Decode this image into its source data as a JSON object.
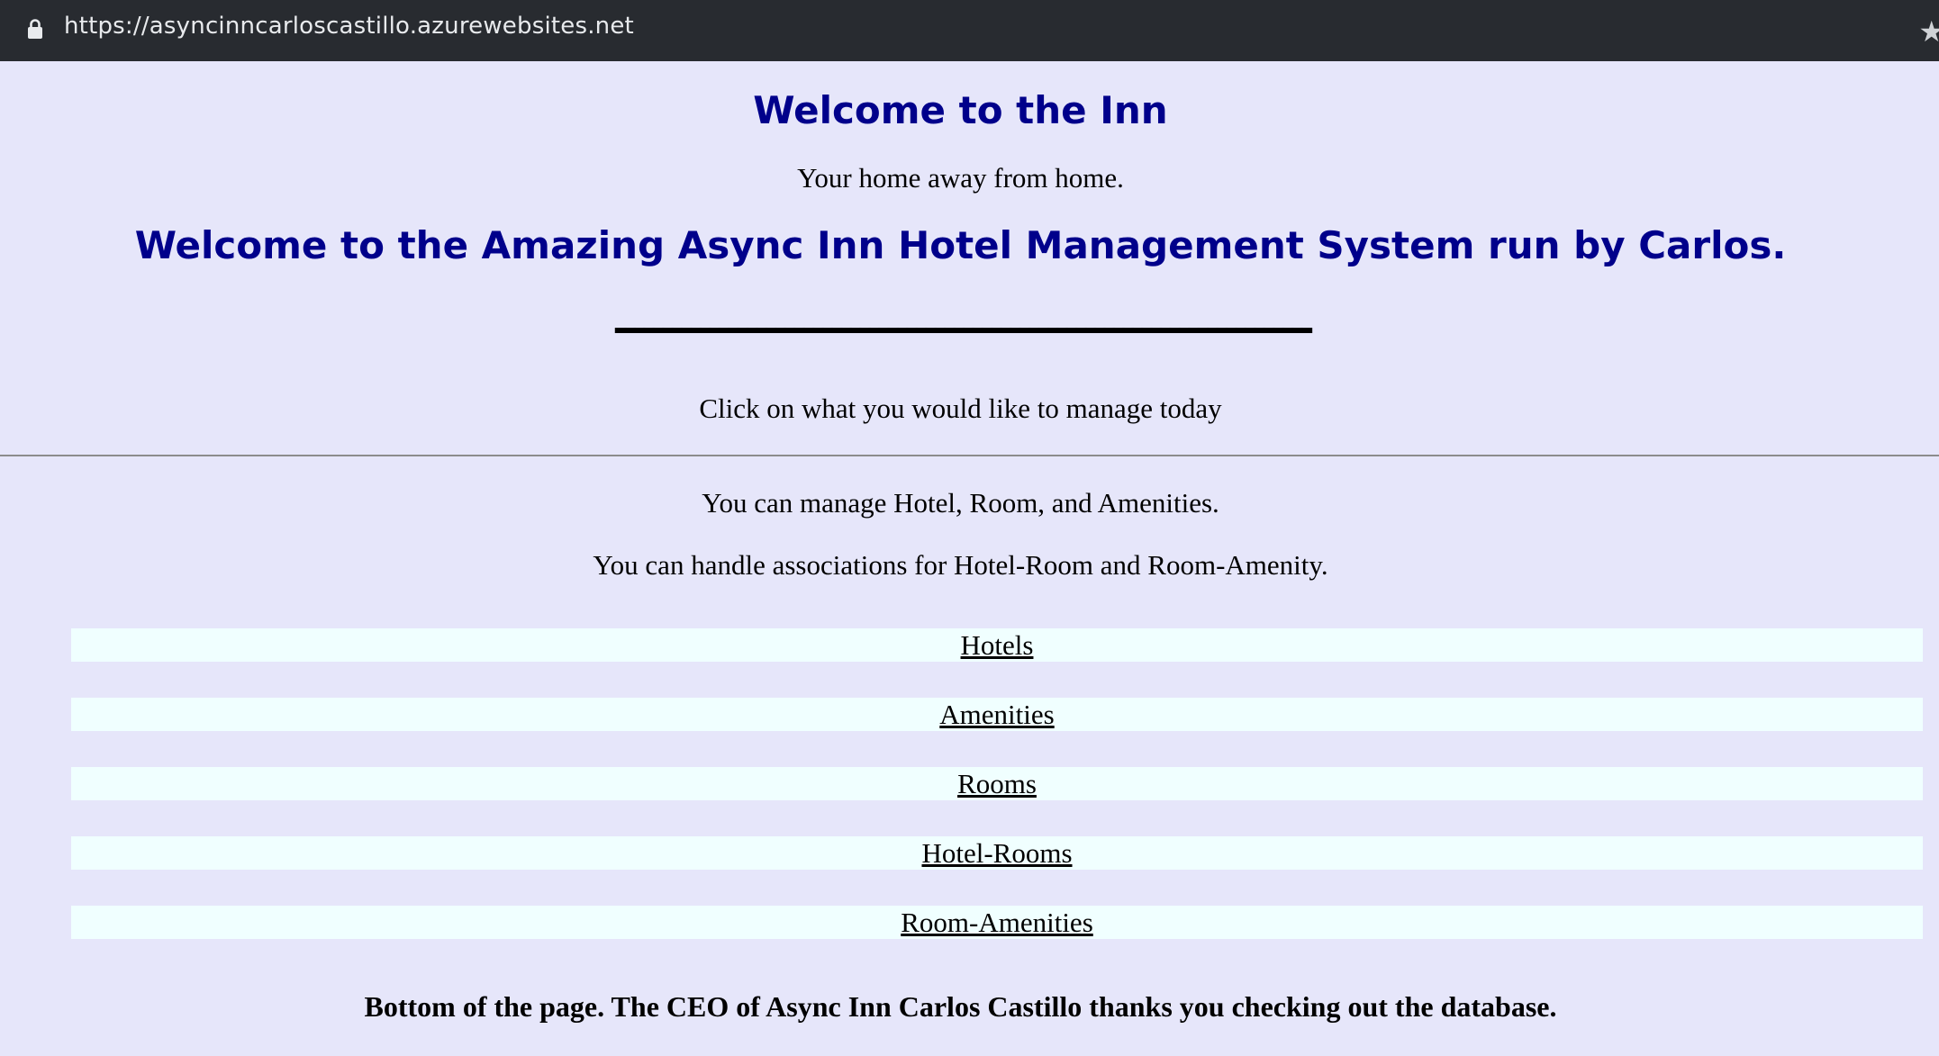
{
  "browser": {
    "url": "https://asyncinncarloscastillo.azurewebsites.net",
    "lock_icon": "lock-icon",
    "star_icon": "star-icon"
  },
  "page": {
    "title": "Welcome to the Inn",
    "tagline": "Your home away from home.",
    "headline": "Welcome to the Amazing Async Inn Hotel Management System run by Carlos.",
    "divider_text": "--------------------------------------------------------------------------",
    "prompt": "Click on what you would like to manage today",
    "manage_text": "You can manage Hotel, Room, and Amenities.",
    "assoc_text": "You can handle associations for Hotel-Room and Room-Amenity.",
    "nav": [
      {
        "label": "Hotels"
      },
      {
        "label": "Amenities"
      },
      {
        "label": "Rooms"
      },
      {
        "label": "Hotel-Rooms"
      },
      {
        "label": "Room-Amenities"
      }
    ],
    "footer": "Bottom of the page. The CEO of Async Inn Carlos Castillo thanks you checking out the database."
  },
  "colors": {
    "page_background": "#e6e6fa",
    "heading": "#00008b",
    "nav_background": "#f0ffff",
    "browser_bar": "#282b30"
  }
}
